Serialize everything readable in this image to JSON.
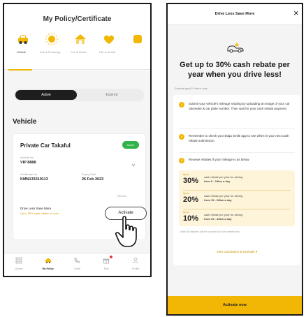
{
  "screenA": {
    "title": "My Policy/Certificate",
    "categories": [
      {
        "label": "Vehicle",
        "icon": "car-icon",
        "active": true
      },
      {
        "label": "Jom & Financing",
        "icon": "sun-icon",
        "active": false
      },
      {
        "label": "Fire & Home",
        "icon": "house-icon",
        "active": false
      },
      {
        "label": "Life & Health",
        "icon": "heart-icon",
        "active": false
      }
    ],
    "tabs": {
      "active": "Active",
      "expired": "Expired"
    },
    "section_title": "Vehicle",
    "policy": {
      "name": "Private Car Takaful",
      "status": "Active",
      "vehicle_no_label": "Vehicle No.",
      "vehicle_no": "VIP 8888",
      "cert_no_label": "Certificate No.",
      "cert_no": "KMN133319113",
      "expiry_label": "Expiry Date",
      "expiry_date": "26 Feb 2023",
      "record_link": "Record",
      "promo_title": "Drive Less Save More",
      "promo_sub": "Up to 30% cash rebate on your",
      "activate_label": "Activate"
    },
    "bottom_nav": [
      {
        "label": "Quotes",
        "icon": "grid-icon",
        "active": false
      },
      {
        "label": "My Policy",
        "icon": "car-icon",
        "active": true
      },
      {
        "label": "Claim",
        "icon": "phone-icon",
        "active": false
      },
      {
        "label": "Play",
        "icon": "gift-icon",
        "active": false
      },
      {
        "label": "Profile",
        "icon": "user-icon",
        "active": false
      }
    ]
  },
  "screenB": {
    "header_title": "Drive Less Save More",
    "close": "×",
    "headline": "Get up to 30% cash rebate per year when you drive less!",
    "subheading": "Sounds good? Here's how",
    "steps": [
      {
        "n": "1",
        "text": "Submit your vehicle's mileage reading by uploading an image of your car odometer & car plate number. Then wait for your cash rebate payment."
      },
      {
        "n": "2",
        "text": "Remember to check your Etiqa Smile app to see when is your next cash rebate submission."
      },
      {
        "n": "3",
        "text": "Receive rebates if your mileage is as below"
      }
    ],
    "rebates": [
      {
        "prefix": "Up to",
        "pct": "30%",
        "line1": "cash rebate per year for driving",
        "line2": "from 0 - 14km a day"
      },
      {
        "prefix": "Up to",
        "pct": "20%",
        "line1": "cash rebate per year for driving",
        "line2": "from 15 - 28km a day"
      },
      {
        "prefix": "Up to",
        "pct": "10%",
        "line1": "cash rebate per year for driving",
        "line2": "from 29 - 43km a day"
      }
    ],
    "note": "Note: All fractions will be rounded up to the nearest km.",
    "calc_link": "View calculation & example ▾",
    "footer_button": "Activate now"
  },
  "colors": {
    "accent": "#f2b705",
    "active_badge": "#2fb34a",
    "dark": "#1e1e1e"
  }
}
